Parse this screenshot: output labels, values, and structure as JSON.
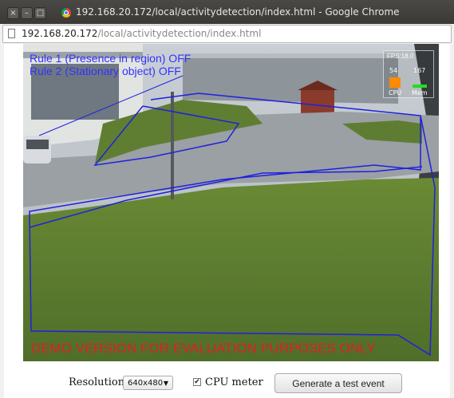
{
  "window": {
    "title": "192.168.20.172/local/activitydetection/index.html - Google Chrome",
    "btn_close": "×",
    "btn_min": "–",
    "btn_max": "□"
  },
  "address_bar": {
    "host": "192.168.20.172",
    "path": "/local/activitydetection/index.html"
  },
  "video": {
    "rules": [
      "Rule 1 (Presence in region) OFF",
      "Rule 2 (Stationary object) OFF"
    ],
    "watermark": "DEMO VERSION FOR EVALUATION PURPOSES ONLY",
    "overlay_color": "#3232ff",
    "watermark_color": "#e02020",
    "meter": {
      "fps_label": "FPS:18.0",
      "cpu_value": "54",
      "mem_value": "167",
      "cpu_label": "CPU",
      "mem_label": "Mem",
      "cpu_color": "#ff8a00",
      "mem_color": "#1ee01e"
    }
  },
  "controls": {
    "resolution_label": "Resolution:",
    "resolution_value": "640x480",
    "resolution_arrow": "▼",
    "cpu_meter_label": "CPU meter",
    "cpu_meter_checked": true,
    "cpu_meter_check": "✔",
    "generate_button": "Generate a test event"
  }
}
